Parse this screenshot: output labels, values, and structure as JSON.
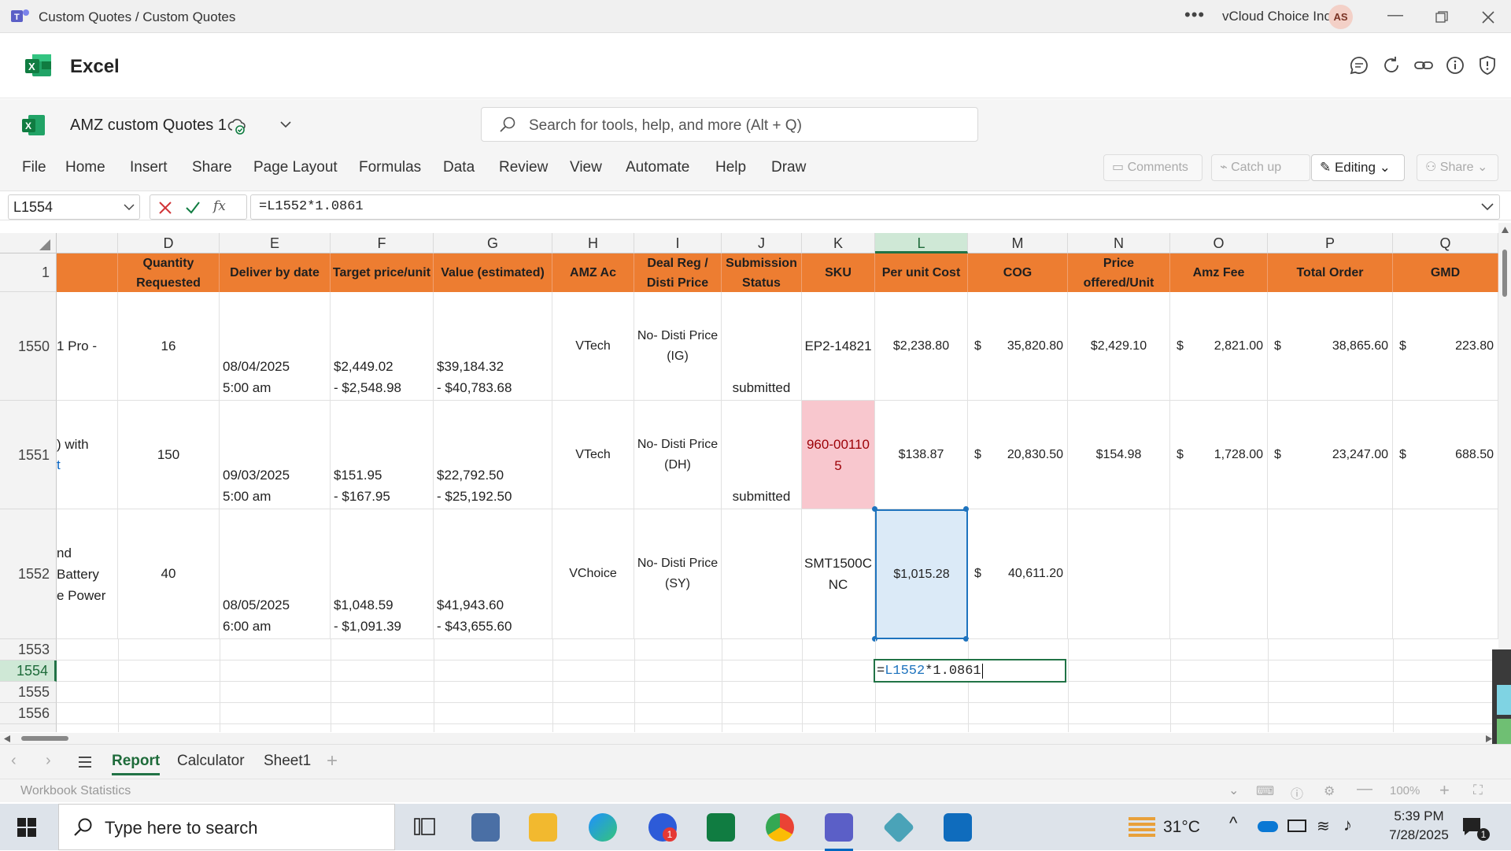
{
  "window": {
    "title": "Custom Quotes / Custom Quotes",
    "org": "vCloud Choice Inc.",
    "avatar_initials": "AS"
  },
  "app": {
    "name": "Excel"
  },
  "doc": {
    "name": "AMZ custom Quotes 1"
  },
  "search": {
    "placeholder": "Search for tools, help, and more (Alt + Q)"
  },
  "ribbon": {
    "tabs": [
      "File",
      "Home",
      "Insert",
      "Share",
      "Page Layout",
      "Formulas",
      "Data",
      "Review",
      "View",
      "Automate",
      "Help",
      "Draw"
    ],
    "comments": "Comments",
    "catchup": "Catch up",
    "editing": "Editing",
    "share": "Share"
  },
  "formula_bar": {
    "name_box": "L1554",
    "formula": "=L1552*1.0861",
    "fx": "fx"
  },
  "columns": [
    "D",
    "E",
    "F",
    "G",
    "H",
    "I",
    "J",
    "K",
    "L",
    "M",
    "N",
    "O",
    "P",
    "Q"
  ],
  "header_row": {
    "row": "1",
    "D": "Quantity Requested",
    "E": "Deliver by date",
    "F": "Target price/unit",
    "G": "Value (estimated)",
    "H": "AMZ Ac",
    "I": "Deal Reg / Disti Price",
    "J": "Submission Status",
    "K": "SKU",
    "L": "Per unit Cost",
    "M": "COG",
    "N": "Price offered/Unit",
    "O": "Amz Fee",
    "P": "Total Order",
    "Q": "GMD"
  },
  "rows": {
    "r1550": {
      "num": "1550",
      "C": "1 Pro -",
      "D": "16",
      "E1": "08/04/2025",
      "E2": "5:00 am",
      "F1": "$2,449.02",
      "F2": "- $2,548.98",
      "G1": "$39,184.32",
      "G2": "- $40,783.68",
      "H": "VTech",
      "I1": "No- Disti Price",
      "I2": "(IG)",
      "J": "submitted",
      "K": "EP2-14821",
      "L": "$2,238.80",
      "M": "35,820.80",
      "N": "$2,429.10",
      "O": "2,821.00",
      "P": "38,865.60",
      "Q": "223.80"
    },
    "r1551": {
      "num": "1551",
      "C1": ") with",
      "C2": "t",
      "D": "150",
      "E1": "09/03/2025",
      "E2": "5:00 am",
      "F1": "$151.95",
      "F2": "- $167.95",
      "G1": "$22,792.50",
      "G2": "- $25,192.50",
      "H": "VTech",
      "I1": "No- Disti Price",
      "I2": "(DH)",
      "J": "submitted",
      "K1": "960-00110",
      "K2": "5",
      "L": "$138.87",
      "M": "20,830.50",
      "N": "$154.98",
      "O": "1,728.00",
      "P": "23,247.00",
      "Q": "688.50"
    },
    "r1552": {
      "num": "1552",
      "C1": "nd",
      "C2": "Battery",
      "C3": "e Power",
      "D": "40",
      "E1": "08/05/2025",
      "E2": "6:00 am",
      "F1": "$1,048.59",
      "F2": "- $1,091.39",
      "G1": "$41,943.60",
      "G2": "- $43,655.60",
      "H": "VChoice",
      "I1": "No- Disti Price",
      "I2": "(SY)",
      "K1": "SMT1500C",
      "K2": "NC",
      "L": "$1,015.28",
      "M": "40,611.20"
    },
    "empty": [
      "1553",
      "1554",
      "1555",
      "1556"
    ],
    "editing_cell": {
      "ref": "L1552",
      "rest": "*1.0861"
    }
  },
  "currency": "$",
  "sheets": {
    "tabs": [
      "Report",
      "Calculator",
      "Sheet1"
    ],
    "add": "+"
  },
  "status": {
    "left": "Workbook Statistics",
    "zoom": "100%"
  },
  "taskbar": {
    "search_placeholder": "Type here to search",
    "weather": "31°C",
    "time": "5:39 PM",
    "date": "7/28/2025",
    "zoom_badge": "1",
    "notif_badge": "1"
  },
  "colors": {
    "accent": "#217346",
    "header_orange": "#ed7d31",
    "sku_pink": "#f8c7ce",
    "selection": "#dbeaf7"
  }
}
